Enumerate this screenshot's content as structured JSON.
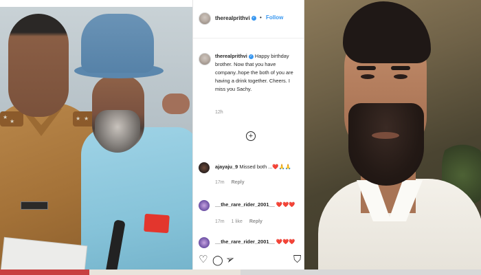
{
  "instagram": {
    "header": {
      "username": "therealprithvi",
      "separator": "•",
      "follow_label": "Follow"
    },
    "caption": {
      "username": "therealprithvi",
      "text": "Happy birthday brother. Now that you have company..hope the both of you are having a drink together. Cheers. I miss you Sachy.",
      "time": "12h"
    },
    "load_more_symbol": "+",
    "comments": [
      {
        "username": "ajayaju_9",
        "text": "Missed both ...❤️🙏🙏",
        "time": "17m",
        "likes": "",
        "reply_label": "Reply"
      },
      {
        "username": "__the_rare_rider_2001__",
        "text": "❤️❤️❤️",
        "time": "17m",
        "likes": "1 like",
        "reply_label": "Reply"
      },
      {
        "username": "__the_rare_rider_2001__",
        "text": "❤️❤️❤️",
        "time": "",
        "likes": "",
        "reply_label": ""
      }
    ],
    "actions": {
      "like_icon": "♡",
      "comment_icon": "◯",
      "share_icon": "➢",
      "save_icon": "⛉"
    }
  },
  "colors": {
    "link_blue": "#3897f0",
    "verified_blue": "#3897f0",
    "text_dark": "#262626",
    "text_muted": "#8e8e8e",
    "heart_red": "#e3362d"
  },
  "icons": [
    "verified-badge-icon",
    "plus-circle-icon",
    "heart-icon",
    "comment-icon",
    "share-icon",
    "bookmark-icon"
  ]
}
